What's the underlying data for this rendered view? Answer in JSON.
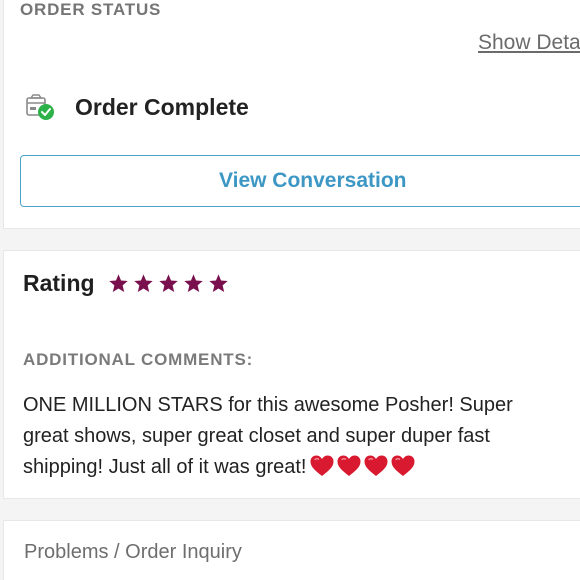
{
  "order_status": {
    "section_title": "ORDER STATUS",
    "show_details": "Show Details",
    "status_icon": "package-check-icon",
    "status_text": "Order Complete",
    "view_conversation": "View Conversation",
    "status_color": "#2db24a"
  },
  "rating": {
    "label": "Rating",
    "stars": 5,
    "max_stars": 5,
    "star_color": "#7a0f4e",
    "comments_title": "ADDITIONAL COMMENTS:",
    "comment": "ONE MILLION STARS for this awesome Posher! Super\ngreat shows, super great closet and super duper fast\nshipping! Just all of it was great!",
    "emoji": "red-heart-icon x4"
  },
  "footer": {
    "problems_label": "Problems / Order Inquiry"
  },
  "colors": {
    "accent_blue": "#3d97c4",
    "heart_red": "#d9192f"
  }
}
